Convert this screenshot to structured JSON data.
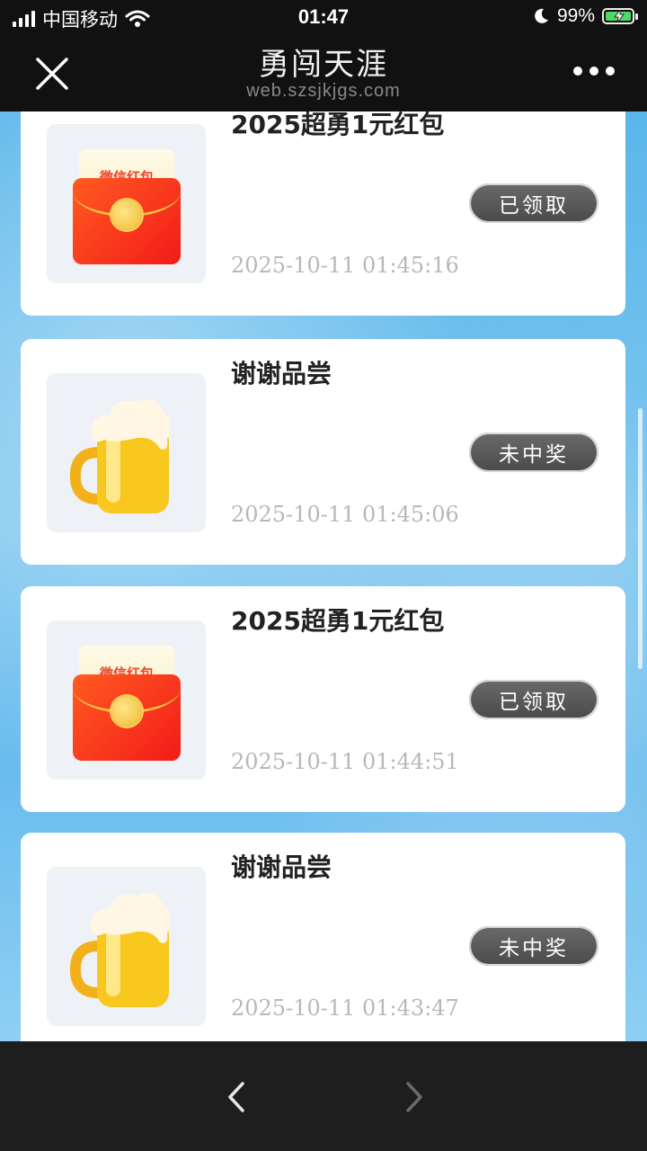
{
  "status_bar": {
    "carrier": "中国移动",
    "time": "01:47",
    "battery_pct": "99%"
  },
  "nav": {
    "title": "勇闯天涯",
    "url": "web.szsjkjgs.com"
  },
  "records": [
    {
      "title": "2025超勇1元红包",
      "status": "已领取",
      "time": "2025-10-11 01:45:16",
      "icon": "red-envelope",
      "icon_text": "微信红包"
    },
    {
      "title": "谢谢品尝",
      "status": "未中奖",
      "time": "2025-10-11 01:45:06",
      "icon": "beer-mug"
    },
    {
      "title": "2025超勇1元红包",
      "status": "已领取",
      "time": "2025-10-11 01:44:51",
      "icon": "red-envelope",
      "icon_text": "微信红包"
    },
    {
      "title": "谢谢品尝",
      "status": "未中奖",
      "time": "2025-10-11 01:43:47",
      "icon": "beer-mug"
    }
  ],
  "colors": {
    "accent_blue": "#68bbee",
    "status_button": "#555555",
    "envelope_red": "#f21c18"
  }
}
